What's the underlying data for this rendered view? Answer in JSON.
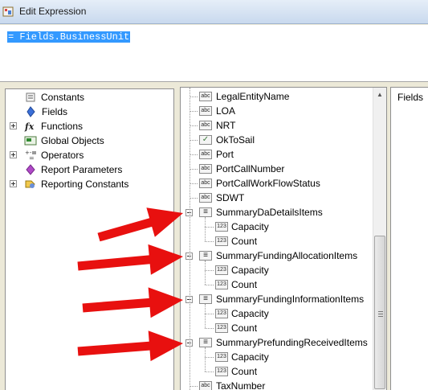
{
  "window": {
    "title": "Edit Expression"
  },
  "editor": {
    "expression": "= Fields.BusinessUnit"
  },
  "categories": [
    {
      "label": "Constants",
      "icon": "constants-icon",
      "expandable": false
    },
    {
      "label": "Fields",
      "icon": "fields-icon",
      "expandable": false
    },
    {
      "label": "Functions",
      "icon": "functions-icon",
      "expandable": true
    },
    {
      "label": "Global Objects",
      "icon": "global-objects-icon",
      "expandable": false
    },
    {
      "label": "Operators",
      "icon": "operators-icon",
      "expandable": true
    },
    {
      "label": "Report Parameters",
      "icon": "report-parameters-icon",
      "expandable": false
    },
    {
      "label": "Reporting Constants",
      "icon": "reporting-constants-icon",
      "expandable": true
    }
  ],
  "fields": {
    "items": [
      {
        "label": "LegalEntityName",
        "kind": "abc",
        "level": 0
      },
      {
        "label": "LOA",
        "kind": "abc",
        "level": 0
      },
      {
        "label": "NRT",
        "kind": "abc",
        "level": 0
      },
      {
        "label": "OkToSail",
        "kind": "check",
        "level": 0
      },
      {
        "label": "Port",
        "kind": "abc",
        "level": 0
      },
      {
        "label": "PortCallNumber",
        "kind": "abc",
        "level": 0
      },
      {
        "label": "PortCallWorkFlowStatus",
        "kind": "abc",
        "level": 0
      },
      {
        "label": "SDWT",
        "kind": "abc",
        "level": 0
      },
      {
        "label": "SummaryDaDetailsItems",
        "kind": "collection",
        "level": 0
      },
      {
        "label": "Capacity",
        "kind": "123",
        "level": 1
      },
      {
        "label": "Count",
        "kind": "123",
        "level": 1
      },
      {
        "label": "SummaryFundingAllocationItems",
        "kind": "collection",
        "level": 0
      },
      {
        "label": "Capacity",
        "kind": "123",
        "level": 1
      },
      {
        "label": "Count",
        "kind": "123",
        "level": 1
      },
      {
        "label": "SummaryFundingInformationItems",
        "kind": "collection",
        "level": 0
      },
      {
        "label": "Capacity",
        "kind": "123",
        "level": 1
      },
      {
        "label": "Count",
        "kind": "123",
        "level": 1
      },
      {
        "label": "SummaryPrefundingReceivedItems",
        "kind": "collection",
        "level": 0
      },
      {
        "label": "Capacity",
        "kind": "123",
        "level": 1
      },
      {
        "label": "Count",
        "kind": "123",
        "level": 1
      },
      {
        "label": "TaxNumber",
        "kind": "abc",
        "level": 0
      }
    ],
    "icon_text": {
      "abc": "abc",
      "123": "123",
      "collection": "≡",
      "check": "✓"
    }
  },
  "right_panel": {
    "label": "Fields"
  },
  "colors": {
    "arrow": "#e8100f",
    "selection": "#3399ff"
  }
}
